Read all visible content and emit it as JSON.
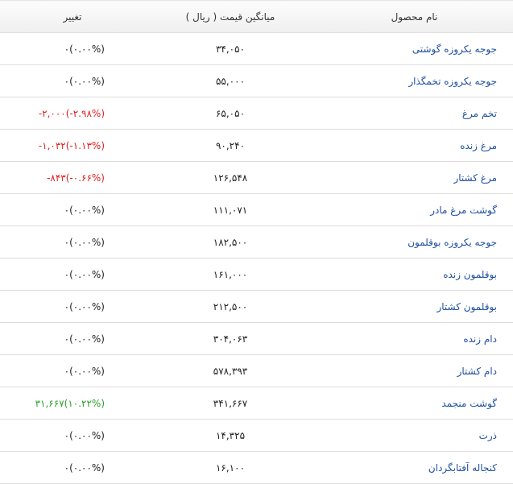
{
  "table": {
    "headers": {
      "name": "نام محصول",
      "price": "میانگین قیمت ( ریال )",
      "change": "تغییر"
    },
    "colors": {
      "name_link": "#1f4fa0",
      "neutral": "#222222",
      "negative": "#e02020",
      "positive": "#2ba02b"
    },
    "rows": [
      {
        "name": "جوجه یکروزه گوشتی",
        "price": "۳۴,۰۵۰",
        "change": "۰(۰.۰۰%)",
        "trend": "neutral"
      },
      {
        "name": "جوجه یکروزه تخمگذار",
        "price": "۵۵,۰۰۰",
        "change": "۰(۰.۰۰%)",
        "trend": "neutral"
      },
      {
        "name": "تخم مرغ",
        "price": "۶۵,۰۵۰",
        "change": "-۲,۰۰۰(-۲.۹۸%)",
        "trend": "negative"
      },
      {
        "name": "مرغ زنده",
        "price": "۹۰,۲۴۰",
        "change": "-۱,۰۳۲(-۱.۱۳%)",
        "trend": "negative"
      },
      {
        "name": "مرغ کشتار",
        "price": "۱۲۶,۵۴۸",
        "change": "-۸۴۳(-۰.۶۶%)",
        "trend": "negative"
      },
      {
        "name": "گوشت مرغ مادر",
        "price": "۱۱۱,۰۷۱",
        "change": "۰(۰.۰۰%)",
        "trend": "neutral"
      },
      {
        "name": "جوجه یکروزه بوقلمون",
        "price": "۱۸۲,۵۰۰",
        "change": "۰(۰.۰۰%)",
        "trend": "neutral"
      },
      {
        "name": "بوقلمون زنده",
        "price": "۱۶۱,۰۰۰",
        "change": "۰(۰.۰۰%)",
        "trend": "neutral"
      },
      {
        "name": "بوقلمون کشتار",
        "price": "۲۱۲,۵۰۰",
        "change": "۰(۰.۰۰%)",
        "trend": "neutral"
      },
      {
        "name": "دام زنده",
        "price": "۳۰۴,۰۶۳",
        "change": "۰(۰.۰۰%)",
        "trend": "neutral"
      },
      {
        "name": "دام کشتار",
        "price": "۵۷۸,۳۹۳",
        "change": "۰(۰.۰۰%)",
        "trend": "neutral"
      },
      {
        "name": "گوشت منجمد",
        "price": "۳۴۱,۶۶۷",
        "change": "۳۱,۶۶۷(۱۰.۲۲%)",
        "trend": "positive"
      },
      {
        "name": "ذرت",
        "price": "۱۴,۳۲۵",
        "change": "۰(۰.۰۰%)",
        "trend": "neutral"
      },
      {
        "name": "کنجاله آفتابگردان",
        "price": "۱۶,۱۰۰",
        "change": "۰(۰.۰۰%)",
        "trend": "neutral"
      }
    ]
  }
}
